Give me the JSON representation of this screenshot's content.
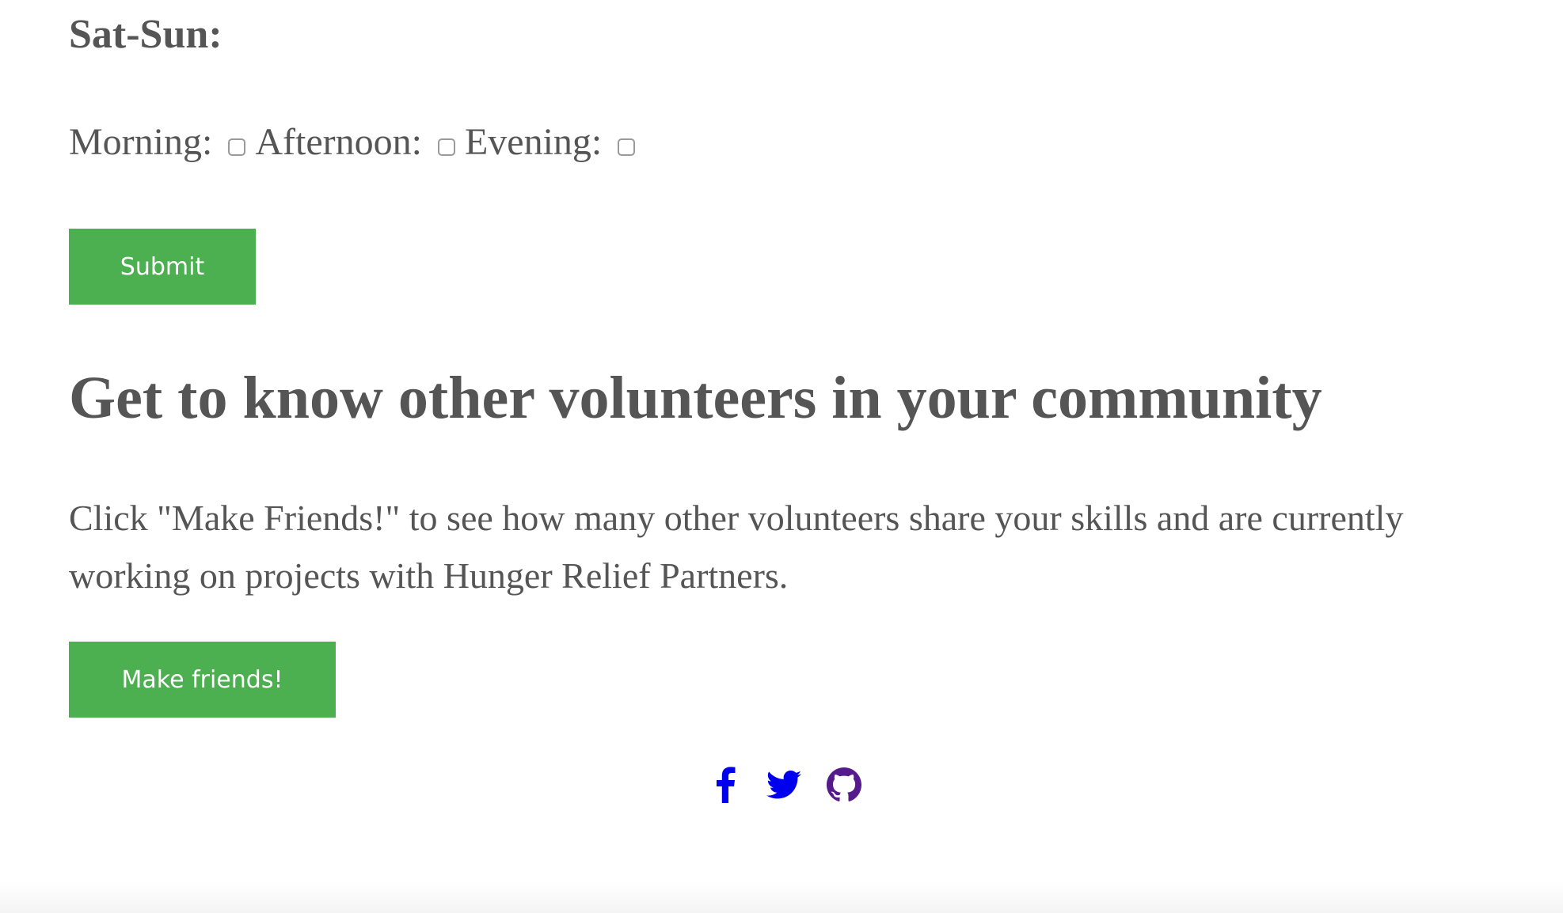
{
  "availability": {
    "day_heading": "Sat-Sun:",
    "slots": [
      {
        "label": "Morning:",
        "checked": false
      },
      {
        "label": "Afternoon:",
        "checked": false
      },
      {
        "label": "Evening:",
        "checked": false
      }
    ],
    "submit_label": "Submit"
  },
  "community": {
    "title": "Get to know other volunteers in your community",
    "description": "Click \"Make Friends!\" to see how many other volunteers share your skills and are currently working on projects with Hunger Relief Partners.",
    "button_label": "Make friends!"
  },
  "social_links": [
    {
      "icon": "facebook-icon",
      "color": "#0000ee"
    },
    {
      "icon": "twitter-icon",
      "color": "#0000ee"
    },
    {
      "icon": "github-icon",
      "color": "#551a8b"
    }
  ],
  "colors": {
    "accent": "#4caf50",
    "text": "#555555",
    "link": "#0000ee",
    "visited_link": "#551a8b"
  }
}
